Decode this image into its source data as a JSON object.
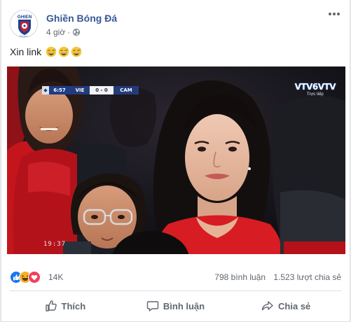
{
  "post": {
    "page_name": "Ghiền Bóng Đá",
    "time": "4 giờ",
    "audience_icon": "globe-icon",
    "avatar_text": "GHIEN BONGDA.VN",
    "caption": "Xin link",
    "caption_emojis": [
      "grinning-sweat-emoji",
      "grinning-sweat-emoji",
      "grinning-sweat-emoji"
    ]
  },
  "media": {
    "scorebug": {
      "time": "6:57",
      "home": "VIE",
      "score": "0 - 0",
      "away": "CAM"
    },
    "channel": {
      "name": "VTV6VTV",
      "status": "Trực tiếp"
    },
    "timecode": "19:37"
  },
  "stats": {
    "reaction_icons": [
      "like-icon",
      "haha-icon",
      "love-icon"
    ],
    "reaction_count": "14K",
    "comments": "798 bình luận",
    "shares": "1.523 lượt chia sẻ"
  },
  "actions": {
    "like": "Thích",
    "comment": "Bình luận",
    "share": "Chia sẻ"
  },
  "colors": {
    "link": "#385898",
    "secondary_text": "#606770",
    "like_blue": "#1877f2",
    "love_red": "#f33e58",
    "haha_yellow": "#f7b125"
  }
}
